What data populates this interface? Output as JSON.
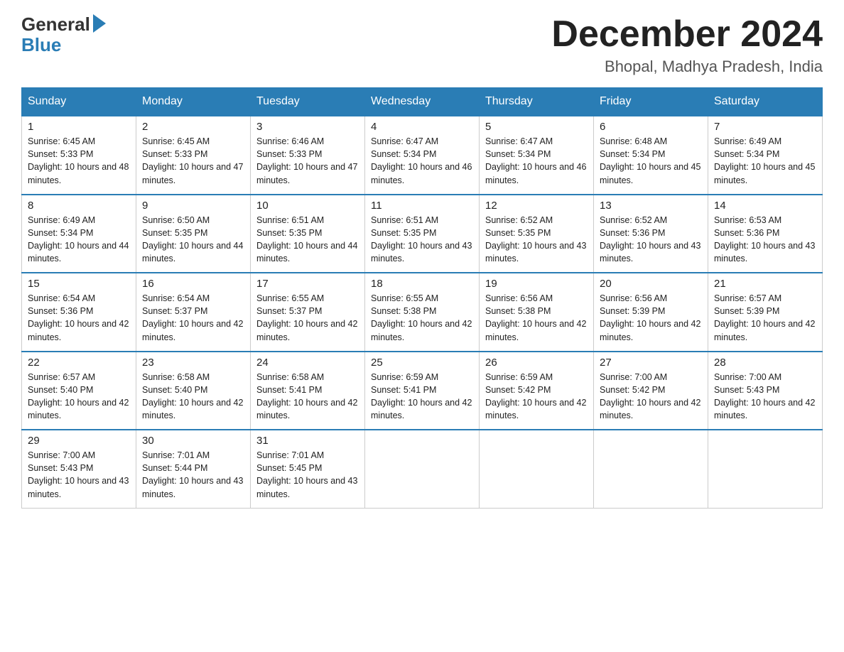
{
  "header": {
    "logo_general": "General",
    "logo_blue": "Blue",
    "month_title": "December 2024",
    "location": "Bhopal, Madhya Pradesh, India"
  },
  "days_of_week": [
    "Sunday",
    "Monday",
    "Tuesday",
    "Wednesday",
    "Thursday",
    "Friday",
    "Saturday"
  ],
  "weeks": [
    [
      {
        "num": "1",
        "sunrise": "6:45 AM",
        "sunset": "5:33 PM",
        "daylight": "10 hours and 48 minutes."
      },
      {
        "num": "2",
        "sunrise": "6:45 AM",
        "sunset": "5:33 PM",
        "daylight": "10 hours and 47 minutes."
      },
      {
        "num": "3",
        "sunrise": "6:46 AM",
        "sunset": "5:33 PM",
        "daylight": "10 hours and 47 minutes."
      },
      {
        "num": "4",
        "sunrise": "6:47 AM",
        "sunset": "5:34 PM",
        "daylight": "10 hours and 46 minutes."
      },
      {
        "num": "5",
        "sunrise": "6:47 AM",
        "sunset": "5:34 PM",
        "daylight": "10 hours and 46 minutes."
      },
      {
        "num": "6",
        "sunrise": "6:48 AM",
        "sunset": "5:34 PM",
        "daylight": "10 hours and 45 minutes."
      },
      {
        "num": "7",
        "sunrise": "6:49 AM",
        "sunset": "5:34 PM",
        "daylight": "10 hours and 45 minutes."
      }
    ],
    [
      {
        "num": "8",
        "sunrise": "6:49 AM",
        "sunset": "5:34 PM",
        "daylight": "10 hours and 44 minutes."
      },
      {
        "num": "9",
        "sunrise": "6:50 AM",
        "sunset": "5:35 PM",
        "daylight": "10 hours and 44 minutes."
      },
      {
        "num": "10",
        "sunrise": "6:51 AM",
        "sunset": "5:35 PM",
        "daylight": "10 hours and 44 minutes."
      },
      {
        "num": "11",
        "sunrise": "6:51 AM",
        "sunset": "5:35 PM",
        "daylight": "10 hours and 43 minutes."
      },
      {
        "num": "12",
        "sunrise": "6:52 AM",
        "sunset": "5:35 PM",
        "daylight": "10 hours and 43 minutes."
      },
      {
        "num": "13",
        "sunrise": "6:52 AM",
        "sunset": "5:36 PM",
        "daylight": "10 hours and 43 minutes."
      },
      {
        "num": "14",
        "sunrise": "6:53 AM",
        "sunset": "5:36 PM",
        "daylight": "10 hours and 43 minutes."
      }
    ],
    [
      {
        "num": "15",
        "sunrise": "6:54 AM",
        "sunset": "5:36 PM",
        "daylight": "10 hours and 42 minutes."
      },
      {
        "num": "16",
        "sunrise": "6:54 AM",
        "sunset": "5:37 PM",
        "daylight": "10 hours and 42 minutes."
      },
      {
        "num": "17",
        "sunrise": "6:55 AM",
        "sunset": "5:37 PM",
        "daylight": "10 hours and 42 minutes."
      },
      {
        "num": "18",
        "sunrise": "6:55 AM",
        "sunset": "5:38 PM",
        "daylight": "10 hours and 42 minutes."
      },
      {
        "num": "19",
        "sunrise": "6:56 AM",
        "sunset": "5:38 PM",
        "daylight": "10 hours and 42 minutes."
      },
      {
        "num": "20",
        "sunrise": "6:56 AM",
        "sunset": "5:39 PM",
        "daylight": "10 hours and 42 minutes."
      },
      {
        "num": "21",
        "sunrise": "6:57 AM",
        "sunset": "5:39 PM",
        "daylight": "10 hours and 42 minutes."
      }
    ],
    [
      {
        "num": "22",
        "sunrise": "6:57 AM",
        "sunset": "5:40 PM",
        "daylight": "10 hours and 42 minutes."
      },
      {
        "num": "23",
        "sunrise": "6:58 AM",
        "sunset": "5:40 PM",
        "daylight": "10 hours and 42 minutes."
      },
      {
        "num": "24",
        "sunrise": "6:58 AM",
        "sunset": "5:41 PM",
        "daylight": "10 hours and 42 minutes."
      },
      {
        "num": "25",
        "sunrise": "6:59 AM",
        "sunset": "5:41 PM",
        "daylight": "10 hours and 42 minutes."
      },
      {
        "num": "26",
        "sunrise": "6:59 AM",
        "sunset": "5:42 PM",
        "daylight": "10 hours and 42 minutes."
      },
      {
        "num": "27",
        "sunrise": "7:00 AM",
        "sunset": "5:42 PM",
        "daylight": "10 hours and 42 minutes."
      },
      {
        "num": "28",
        "sunrise": "7:00 AM",
        "sunset": "5:43 PM",
        "daylight": "10 hours and 42 minutes."
      }
    ],
    [
      {
        "num": "29",
        "sunrise": "7:00 AM",
        "sunset": "5:43 PM",
        "daylight": "10 hours and 43 minutes."
      },
      {
        "num": "30",
        "sunrise": "7:01 AM",
        "sunset": "5:44 PM",
        "daylight": "10 hours and 43 minutes."
      },
      {
        "num": "31",
        "sunrise": "7:01 AM",
        "sunset": "5:45 PM",
        "daylight": "10 hours and 43 minutes."
      },
      null,
      null,
      null,
      null
    ]
  ]
}
